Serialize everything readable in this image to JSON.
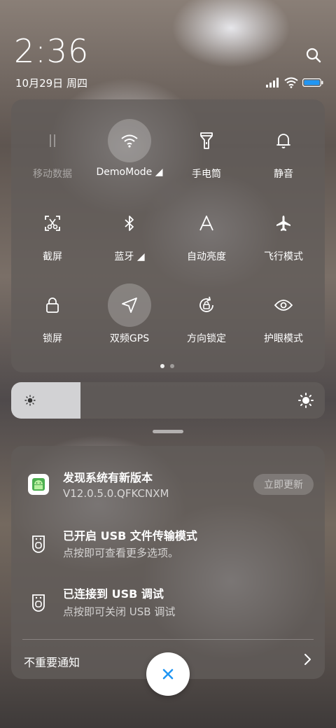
{
  "status": {
    "time": "2:36",
    "date": "10月29日 周四",
    "icons": [
      "signal-icon",
      "wifi-icon",
      "battery-icon"
    ]
  },
  "quick_settings": {
    "tiles": [
      {
        "label": "移动数据",
        "icon": "mobile-data-icon",
        "state": "disabled"
      },
      {
        "label": "DemoMode ◢",
        "icon": "wifi-icon",
        "state": "on"
      },
      {
        "label": "手电筒",
        "icon": "flashlight-icon",
        "state": "off"
      },
      {
        "label": "静音",
        "icon": "bell-icon",
        "state": "off"
      },
      {
        "label": "截屏",
        "icon": "screenshot-icon",
        "state": "off"
      },
      {
        "label": "蓝牙 ◢",
        "icon": "bluetooth-icon",
        "state": "off"
      },
      {
        "label": "自动亮度",
        "icon": "auto-brightness-icon",
        "state": "off"
      },
      {
        "label": "飞行模式",
        "icon": "airplane-icon",
        "state": "off"
      },
      {
        "label": "锁屏",
        "icon": "lock-icon",
        "state": "off"
      },
      {
        "label": "双频GPS",
        "icon": "location-arrow-icon",
        "state": "on"
      },
      {
        "label": "方向锁定",
        "icon": "rotation-lock-icon",
        "state": "off"
      },
      {
        "label": "护眼模式",
        "icon": "eye-icon",
        "state": "off"
      }
    ],
    "page_count": 2,
    "current_page": 1
  },
  "brightness": {
    "level": 0.22
  },
  "notifications": [
    {
      "title": "发现系统有新版本",
      "subtitle": "V12.0.5.0.QFKCNXM",
      "icon": "android-update-icon",
      "action": "立即更新"
    },
    {
      "title": "已开启 USB 文件传输模式",
      "subtitle": "点按即可查看更多选项。",
      "icon": "usb-icon"
    },
    {
      "title": "已连接到 USB 调试",
      "subtitle": "点按即可关闭 USB 调试",
      "icon": "usb-icon"
    }
  ],
  "unimportant_label": "不重要通知",
  "colors": {
    "accent": "#2196f3",
    "panel": "#625c5a"
  }
}
